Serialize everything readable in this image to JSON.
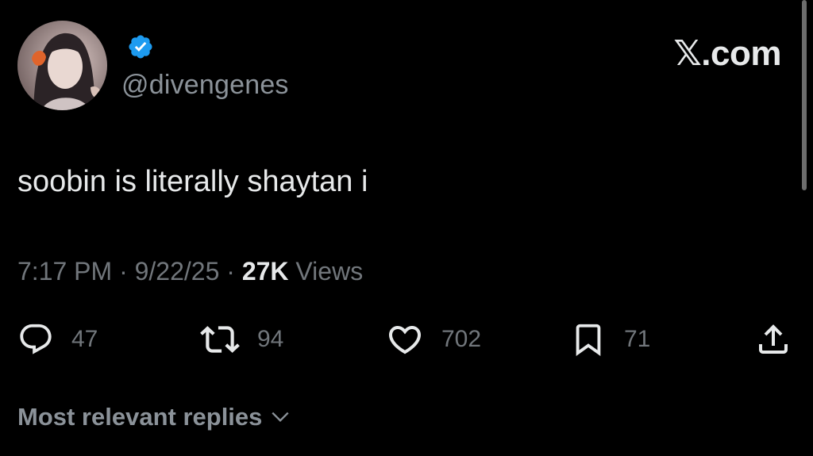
{
  "author": {
    "handle": "@divengenes",
    "verified": true,
    "verified_color": "#1d9bf0",
    "avatar_icon": "profile-photo"
  },
  "brand": {
    "label": "𝕏.com"
  },
  "post": {
    "text": "soobin is literally shaytan i"
  },
  "meta": {
    "time": "7:17 PM",
    "separator": "·",
    "date": "9/22/25",
    "views_count": "27K",
    "views_label": "Views"
  },
  "actions": {
    "reply": {
      "icon": "reply-icon",
      "count": "47"
    },
    "repost": {
      "icon": "repost-icon",
      "count": "94"
    },
    "like": {
      "icon": "heart-icon",
      "count": "702"
    },
    "bookmark": {
      "icon": "bookmark-icon",
      "count": "71"
    },
    "share": {
      "icon": "share-icon"
    }
  },
  "replies": {
    "label": "Most relevant replies"
  },
  "colors": {
    "background": "#000000",
    "primary_text": "#e7e9ea",
    "secondary_text": "#71767b"
  }
}
